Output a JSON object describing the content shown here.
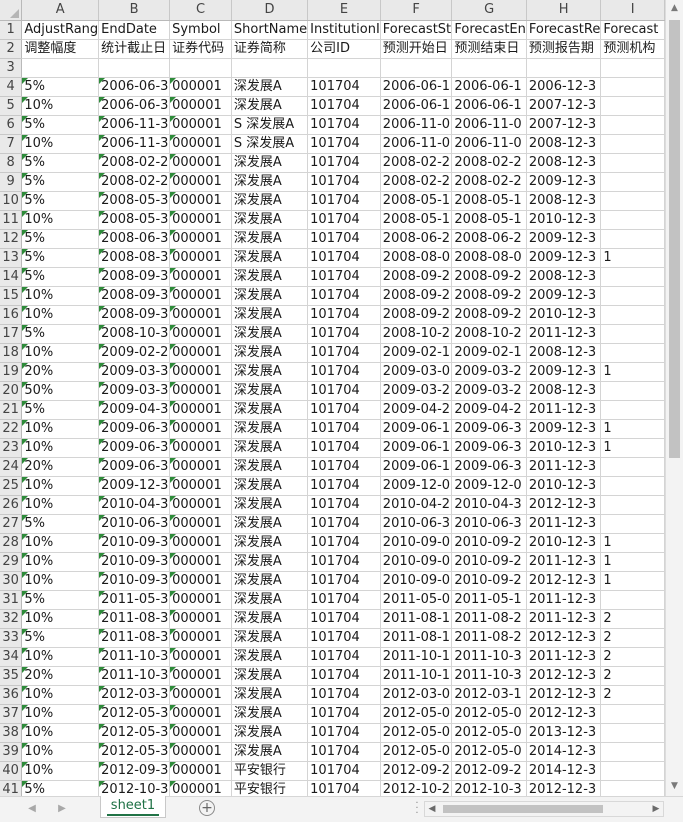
{
  "columns": [
    "A",
    "B",
    "C",
    "D",
    "E",
    "F",
    "G",
    "H",
    "I"
  ],
  "rows": [
    {
      "n": "1",
      "c": [
        "AdjustRang",
        "EndDate",
        "Symbol",
        "ShortName",
        "InstitutionI",
        "ForecastSt",
        "ForecastEn",
        "ForecastRe",
        "Forecast"
      ]
    },
    {
      "n": "2",
      "c": [
        "调整幅度",
        "统计截止日",
        "证券代码",
        "证券简称",
        "公司ID",
        "预测开始日",
        "预测结束日",
        "预测报告期",
        "预测机构"
      ]
    },
    {
      "n": "3",
      "c": [
        "",
        "",
        "",
        "",
        "",
        "",
        "",
        "",
        ""
      ]
    },
    {
      "n": "4",
      "c": [
        "5%",
        "2006-06-3",
        "000001",
        "深发展A",
        "101704",
        "2006-06-1",
        "2006-06-1",
        "2006-12-3",
        ""
      ]
    },
    {
      "n": "5",
      "c": [
        "10%",
        "2006-06-3",
        "000001",
        "深发展A",
        "101704",
        "2006-06-1",
        "2006-06-1",
        "2007-12-3",
        ""
      ]
    },
    {
      "n": "6",
      "c": [
        "5%",
        "2006-11-3",
        "000001",
        "S 深发展A",
        "101704",
        "2006-11-0",
        "2006-11-0",
        "2007-12-3",
        ""
      ]
    },
    {
      "n": "7",
      "c": [
        "10%",
        "2006-11-3",
        "000001",
        "S 深发展A",
        "101704",
        "2006-11-0",
        "2006-11-0",
        "2008-12-3",
        ""
      ]
    },
    {
      "n": "8",
      "c": [
        "5%",
        "2008-02-2",
        "000001",
        "深发展A",
        "101704",
        "2008-02-2",
        "2008-02-2",
        "2008-12-3",
        ""
      ]
    },
    {
      "n": "9",
      "c": [
        "5%",
        "2008-02-2",
        "000001",
        "深发展A",
        "101704",
        "2008-02-2",
        "2008-02-2",
        "2009-12-3",
        ""
      ]
    },
    {
      "n": "10",
      "c": [
        "5%",
        "2008-05-3",
        "000001",
        "深发展A",
        "101704",
        "2008-05-1",
        "2008-05-1",
        "2008-12-3",
        ""
      ]
    },
    {
      "n": "11",
      "c": [
        "10%",
        "2008-05-3",
        "000001",
        "深发展A",
        "101704",
        "2008-05-1",
        "2008-05-1",
        "2010-12-3",
        ""
      ]
    },
    {
      "n": "12",
      "c": [
        "5%",
        "2008-06-3",
        "000001",
        "深发展A",
        "101704",
        "2008-06-2",
        "2008-06-2",
        "2009-12-3",
        ""
      ]
    },
    {
      "n": "13",
      "c": [
        "5%",
        "2008-08-3",
        "000001",
        "深发展A",
        "101704",
        "2008-08-0",
        "2008-08-0",
        "2009-12-3",
        "1"
      ]
    },
    {
      "n": "14",
      "c": [
        "5%",
        "2008-09-3",
        "000001",
        "深发展A",
        "101704",
        "2008-09-2",
        "2008-09-2",
        "2008-12-3",
        ""
      ]
    },
    {
      "n": "15",
      "c": [
        "10%",
        "2008-09-3",
        "000001",
        "深发展A",
        "101704",
        "2008-09-2",
        "2008-09-2",
        "2009-12-3",
        ""
      ]
    },
    {
      "n": "16",
      "c": [
        "10%",
        "2008-09-3",
        "000001",
        "深发展A",
        "101704",
        "2008-09-2",
        "2008-09-2",
        "2010-12-3",
        ""
      ]
    },
    {
      "n": "17",
      "c": [
        "5%",
        "2008-10-3",
        "000001",
        "深发展A",
        "101704",
        "2008-10-2",
        "2008-10-2",
        "2011-12-3",
        ""
      ]
    },
    {
      "n": "18",
      "c": [
        "10%",
        "2009-02-2",
        "000001",
        "深发展A",
        "101704",
        "2009-02-1",
        "2009-02-1",
        "2008-12-3",
        ""
      ]
    },
    {
      "n": "19",
      "c": [
        "20%",
        "2009-03-3",
        "000001",
        "深发展A",
        "101704",
        "2009-03-0",
        "2009-03-2",
        "2009-12-3",
        "1"
      ]
    },
    {
      "n": "20",
      "c": [
        "50%",
        "2009-03-3",
        "000001",
        "深发展A",
        "101704",
        "2009-03-2",
        "2009-03-2",
        "2008-12-3",
        ""
      ]
    },
    {
      "n": "21",
      "c": [
        "5%",
        "2009-04-3",
        "000001",
        "深发展A",
        "101704",
        "2009-04-2",
        "2009-04-2",
        "2011-12-3",
        ""
      ]
    },
    {
      "n": "22",
      "c": [
        "10%",
        "2009-06-3",
        "000001",
        "深发展A",
        "101704",
        "2009-06-1",
        "2009-06-3",
        "2009-12-3",
        "1"
      ]
    },
    {
      "n": "23",
      "c": [
        "10%",
        "2009-06-3",
        "000001",
        "深发展A",
        "101704",
        "2009-06-1",
        "2009-06-3",
        "2010-12-3",
        "1"
      ]
    },
    {
      "n": "24",
      "c": [
        "20%",
        "2009-06-3",
        "000001",
        "深发展A",
        "101704",
        "2009-06-1",
        "2009-06-3",
        "2011-12-3",
        ""
      ]
    },
    {
      "n": "25",
      "c": [
        "10%",
        "2009-12-3",
        "000001",
        "深发展A",
        "101704",
        "2009-12-0",
        "2009-12-0",
        "2010-12-3",
        ""
      ]
    },
    {
      "n": "26",
      "c": [
        "10%",
        "2010-04-3",
        "000001",
        "深发展A",
        "101704",
        "2010-04-2",
        "2010-04-3",
        "2012-12-3",
        ""
      ]
    },
    {
      "n": "27",
      "c": [
        "5%",
        "2010-06-3",
        "000001",
        "深发展A",
        "101704",
        "2010-06-3",
        "2010-06-3",
        "2011-12-3",
        ""
      ]
    },
    {
      "n": "28",
      "c": [
        "10%",
        "2010-09-3",
        "000001",
        "深发展A",
        "101704",
        "2010-09-0",
        "2010-09-2",
        "2010-12-3",
        "1"
      ]
    },
    {
      "n": "29",
      "c": [
        "10%",
        "2010-09-3",
        "000001",
        "深发展A",
        "101704",
        "2010-09-0",
        "2010-09-2",
        "2011-12-3",
        "1"
      ]
    },
    {
      "n": "30",
      "c": [
        "10%",
        "2010-09-3",
        "000001",
        "深发展A",
        "101704",
        "2010-09-0",
        "2010-09-2",
        "2012-12-3",
        "1"
      ]
    },
    {
      "n": "31",
      "c": [
        "5%",
        "2011-05-3",
        "000001",
        "深发展A",
        "101704",
        "2011-05-0",
        "2011-05-1",
        "2011-12-3",
        ""
      ]
    },
    {
      "n": "32",
      "c": [
        "10%",
        "2011-08-3",
        "000001",
        "深发展A",
        "101704",
        "2011-08-1",
        "2011-08-2",
        "2011-12-3",
        "2"
      ]
    },
    {
      "n": "33",
      "c": [
        "5%",
        "2011-08-3",
        "000001",
        "深发展A",
        "101704",
        "2011-08-1",
        "2011-08-2",
        "2012-12-3",
        "2"
      ]
    },
    {
      "n": "34",
      "c": [
        "10%",
        "2011-10-3",
        "000001",
        "深发展A",
        "101704",
        "2011-10-1",
        "2011-10-3",
        "2011-12-3",
        "2"
      ]
    },
    {
      "n": "35",
      "c": [
        "20%",
        "2011-10-3",
        "000001",
        "深发展A",
        "101704",
        "2011-10-1",
        "2011-10-3",
        "2012-12-3",
        "2"
      ]
    },
    {
      "n": "36",
      "c": [
        "10%",
        "2012-03-3",
        "000001",
        "深发展A",
        "101704",
        "2012-03-0",
        "2012-03-1",
        "2012-12-3",
        "2"
      ]
    },
    {
      "n": "37",
      "c": [
        "10%",
        "2012-05-3",
        "000001",
        "深发展A",
        "101704",
        "2012-05-0",
        "2012-05-0",
        "2012-12-3",
        ""
      ]
    },
    {
      "n": "38",
      "c": [
        "10%",
        "2012-05-3",
        "000001",
        "深发展A",
        "101704",
        "2012-05-0",
        "2012-05-0",
        "2013-12-3",
        ""
      ]
    },
    {
      "n": "39",
      "c": [
        "10%",
        "2012-05-3",
        "000001",
        "深发展A",
        "101704",
        "2012-05-0",
        "2012-05-0",
        "2014-12-3",
        ""
      ]
    },
    {
      "n": "40",
      "c": [
        "10%",
        "2012-09-3",
        "000001",
        "平安银行",
        "101704",
        "2012-09-2",
        "2012-09-2",
        "2014-12-3",
        ""
      ]
    },
    {
      "n": "41",
      "c": [
        "5%",
        "2012-10-3",
        "000001",
        "平安银行",
        "101704",
        "2012-10-2",
        "2012-10-3",
        "2012-12-3",
        ""
      ]
    }
  ],
  "sheet_tabs": [
    {
      "label": "sheet1",
      "active": true
    }
  ],
  "add_sheet_label": "⊕",
  "colors": {
    "header_bg": "#e9e9e9",
    "gridline": "#d4d4d4",
    "text_indicator": "#2e8b3a",
    "tab_text": "#1e7145"
  },
  "icons": {
    "scroll_up": "triangle-up-icon",
    "scroll_down": "triangle-down-icon",
    "scroll_left": "triangle-left-icon",
    "scroll_right": "triangle-right-icon",
    "add_sheet": "plus-circle-icon",
    "select_all": "select-all-triangle-icon"
  }
}
